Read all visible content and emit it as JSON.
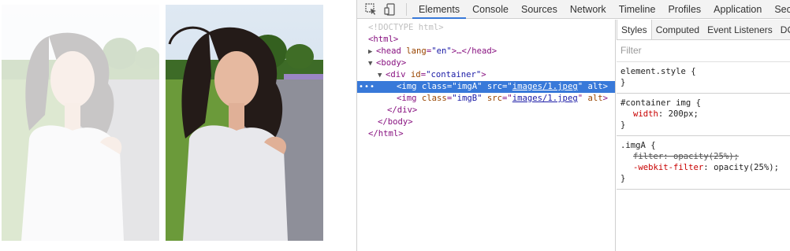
{
  "page": {
    "photo_a_label": "imgA",
    "photo_b_label": "imgB",
    "photo_a_opacity": 0.25
  },
  "toolbar": {
    "inspect_icon": "inspect-element-icon",
    "device_icon": "device-mode-icon",
    "tabs": [
      "Elements",
      "Console",
      "Sources",
      "Network",
      "Timeline",
      "Profiles",
      "Application",
      "Securit"
    ],
    "active_tab": "Elements"
  },
  "elements": {
    "doctype": "<!DOCTYPE html>",
    "html_open": "<html>",
    "head": "head",
    "head_attr": "lang",
    "head_attr_val": "\"en\"",
    "head_rest": ">…</head>",
    "body_open": "body",
    "div_tag": "div",
    "div_attr": "id",
    "div_attr_val": "\"container\"",
    "img_tag": "img",
    "class_attr": "class",
    "imgA_class": "\"imgA\"",
    "imgB_class": "\"imgB\"",
    "src_attr": "src",
    "src_val": "images/1.jpeg",
    "alt_attr": "alt",
    "div_close": "</div>",
    "body_close": "</body>",
    "html_close": "</html>",
    "selected_dots": "•••"
  },
  "styles": {
    "subtabs": [
      "Styles",
      "Computed",
      "Event Listeners",
      "DO"
    ],
    "filter_placeholder": "Filter",
    "rules": {
      "element_style": {
        "selector": "element.style {",
        "close": "}"
      },
      "container_img": {
        "selector": "#container img {",
        "prop": "width",
        "value": "200px;",
        "close": "}"
      },
      "imgA": {
        "selector": ".imgA {",
        "prop1": "filter",
        "value1": "opacity(25%);",
        "prop2": "-webkit-filter",
        "value2": "opacity(25%);",
        "close": "}"
      }
    }
  },
  "colors": {
    "accent": "#3879d9",
    "tag": "#881280",
    "attr_name": "#994500",
    "attr_value": "#1a1aa6",
    "css_prop": "#c80000"
  }
}
